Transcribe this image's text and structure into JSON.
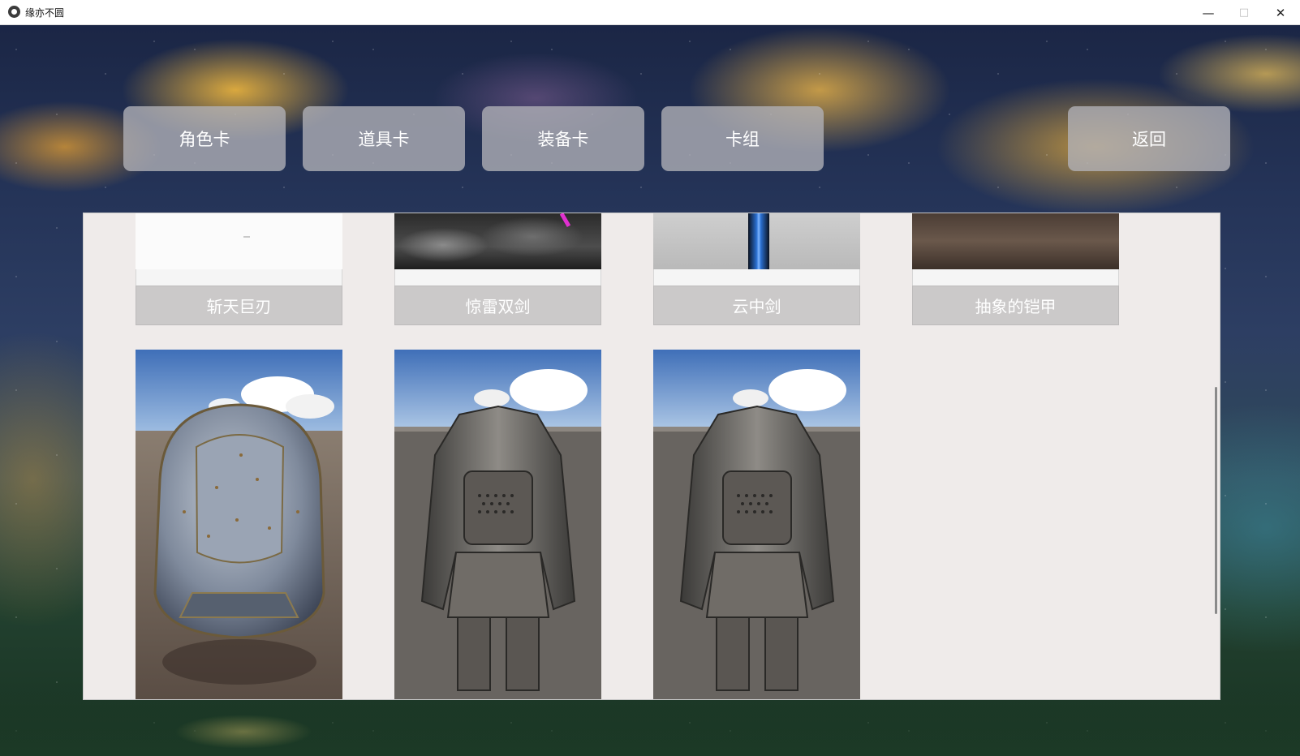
{
  "window": {
    "title": "缘亦不圆"
  },
  "nav": {
    "buttons": [
      "角色卡",
      "道具卡",
      "装备卡",
      "卡组"
    ],
    "back": "返回"
  },
  "cards": [
    {
      "name": "斩天巨刃"
    },
    {
      "name": "惊雷双剑"
    },
    {
      "name": "云中剑"
    },
    {
      "name": "抽象的铠甲"
    }
  ]
}
